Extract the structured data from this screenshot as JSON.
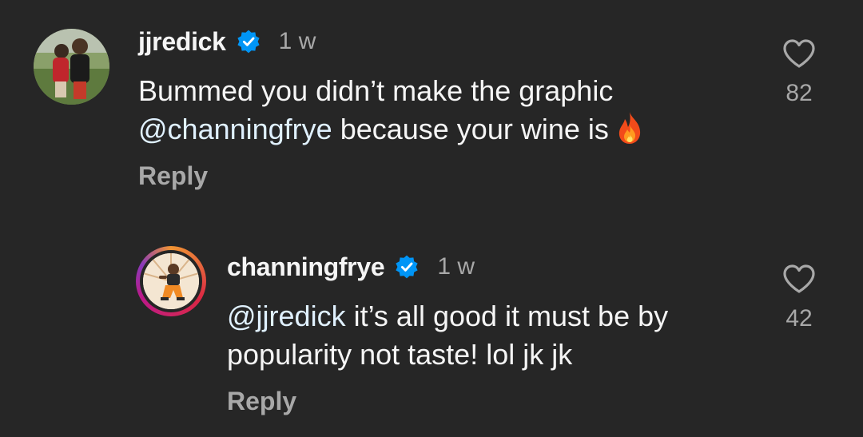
{
  "comments": [
    {
      "username": "jjredick",
      "verified": true,
      "time": "1 w",
      "text_before": "Bummed you didn’t make the graphic ",
      "mention": "@channingfrye",
      "text_after": " because your wine is",
      "emoji": "fire",
      "reply_label": "Reply",
      "likes": "82"
    },
    {
      "username": "channingfrye",
      "verified": true,
      "time": "1 w",
      "mention": "@jjredick",
      "text_after": " it’s all good it must be by popularity not taste! lol jk jk",
      "reply_label": "Reply",
      "likes": "42"
    }
  ],
  "colors": {
    "background": "#262626",
    "primary_text": "#f5f5f5",
    "secondary_text": "#a8a8a8",
    "mention": "#e0f1ff",
    "verified_blue": "#0095f6"
  }
}
